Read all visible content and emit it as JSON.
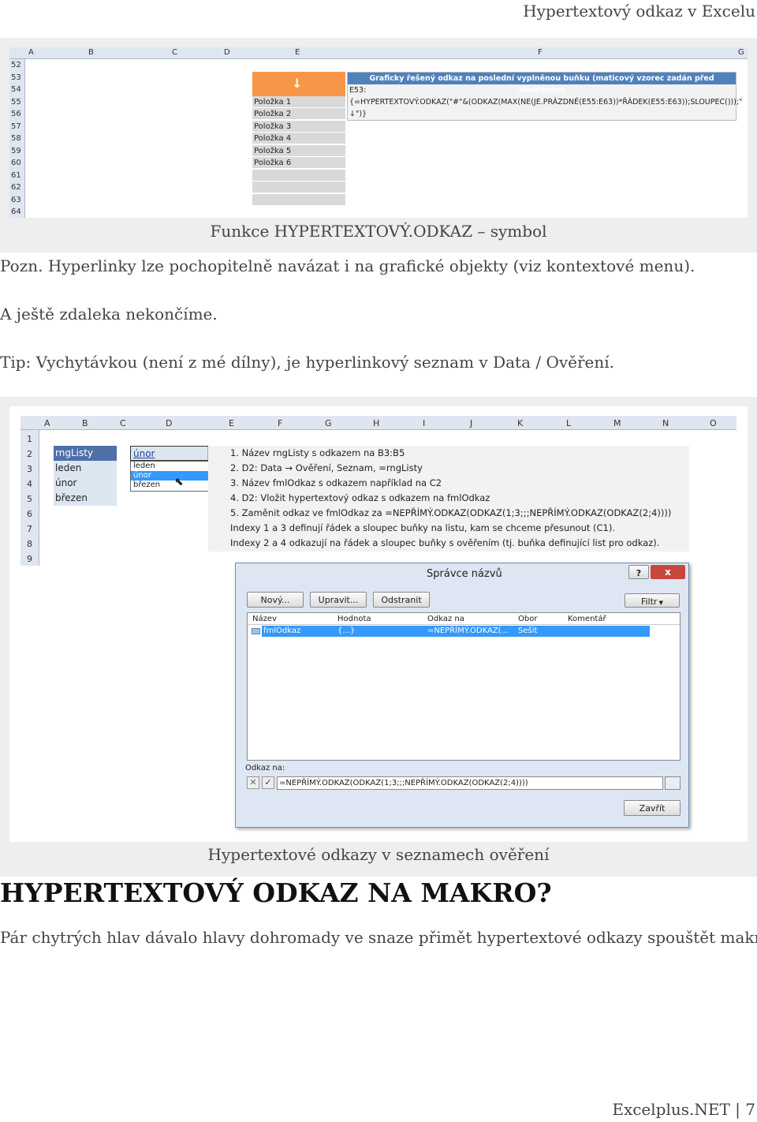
{
  "header": {
    "title": "Hypertextový odkaz v Excelu"
  },
  "figure1": {
    "caption": "Funkce HYPERTEXTOVÝ.ODKAZ – symbol",
    "columns": [
      "A",
      "B",
      "C",
      "D",
      "E",
      "F",
      "G"
    ],
    "rows": [
      "52",
      "53",
      "54",
      "55",
      "56",
      "57",
      "58",
      "59",
      "60",
      "61",
      "62",
      "63",
      "64"
    ],
    "arrow": "↓",
    "items": [
      "Položka 1",
      "Položka 2",
      "Položka 3",
      "Položka 4",
      "Položka 5",
      "Položka 6"
    ],
    "note_title": "Graficky řešený odkaz na poslední vyplněnou buňku (maticový vzorec zadán před sloučením)",
    "note_line1": "E53:",
    "note_line2": "{=HYPERTEXTOVÝ.ODKAZ(\"#\"&(ODKAZ(MAX(NE(JE.PRÁZDNÉ(E55:E63))*ŘÁDEK(E55:E63));SLOUPEC()));\"",
    "note_line3": "↓\")}"
  },
  "body": {
    "p1": "Pozn. Hyperlinky lze pochopitelně navázat i na grafické objekty (viz kontextové menu).",
    "p2": "A ještě zdaleka nekončíme.",
    "p3": "Tip: Vychytávkou (není z mé dílny), je hyperlinkový seznam v Data / Ověření."
  },
  "figure2": {
    "caption": "Hypertextové odkazy v seznamech ověření",
    "columns": [
      "A",
      "B",
      "C",
      "D",
      "E",
      "F",
      "G",
      "H",
      "I",
      "J",
      "K",
      "L",
      "M",
      "N",
      "O"
    ],
    "rows": [
      "1",
      "2",
      "3",
      "4",
      "5",
      "6",
      "7",
      "8",
      "9"
    ],
    "list": [
      "rngListy",
      "leden",
      "únor",
      "březen"
    ],
    "dropdown_value": "únor",
    "dropdown_options": [
      "leden",
      "únor",
      "březen"
    ],
    "notes": [
      "1. Název rngListy s odkazem na B3:B5",
      "2. D2: Data → Ověření, Seznam, =rngListy",
      "3. Název fmlOdkaz s odkazem například na C2",
      "4. D2: Vložit hypertextový odkaz  s odkazem na fmlOdkaz",
      "5. Zaměnit odkaz ve fmlOdkaz za =NEPŘÍMÝ.ODKAZ(ODKAZ(1;3;;;NEPŘÍMÝ.ODKAZ(ODKAZ(2;4))))",
      "Indexy 1 a 3 definují řádek a sloupec buňky na listu, kam se chceme přesunout (C1).",
      "Indexy 2 a 4 odkazují na řádek a sloupec buňky s ověřením (tj. buňka definující list pro odkaz)."
    ],
    "dialog": {
      "title": "Správce názvů",
      "help": "?",
      "close": "x",
      "new": "Nový...",
      "edit": "Upravit...",
      "delete": "Odstranit",
      "filter": "Filtr",
      "columns": [
        "Název",
        "Hodnota",
        "Odkaz na",
        "Obor",
        "Komentář"
      ],
      "row": [
        "fmlOdkaz",
        "{...}",
        "=NEPŘÍMÝ.ODKAZ(...",
        "Sešit",
        ""
      ],
      "refers_label": "Odkaz na:",
      "refers_value": "=NEPŘÍMÝ.ODKAZ(ODKAZ(1;3;;;NEPŘÍMÝ.ODKAZ(ODKAZ(2;4))))",
      "close_btn": "Zavřít"
    }
  },
  "section": {
    "heading": "HYPERTEXTOVÝ ODKAZ NA MAKRO?",
    "p": "Pár chytrých hlav dávalo hlavy dohromady ve snaze přimět hypertextové odkazy spouštět makra."
  },
  "footer": {
    "site": "Excelplus.NET",
    "sep": "|",
    "page": "7"
  }
}
